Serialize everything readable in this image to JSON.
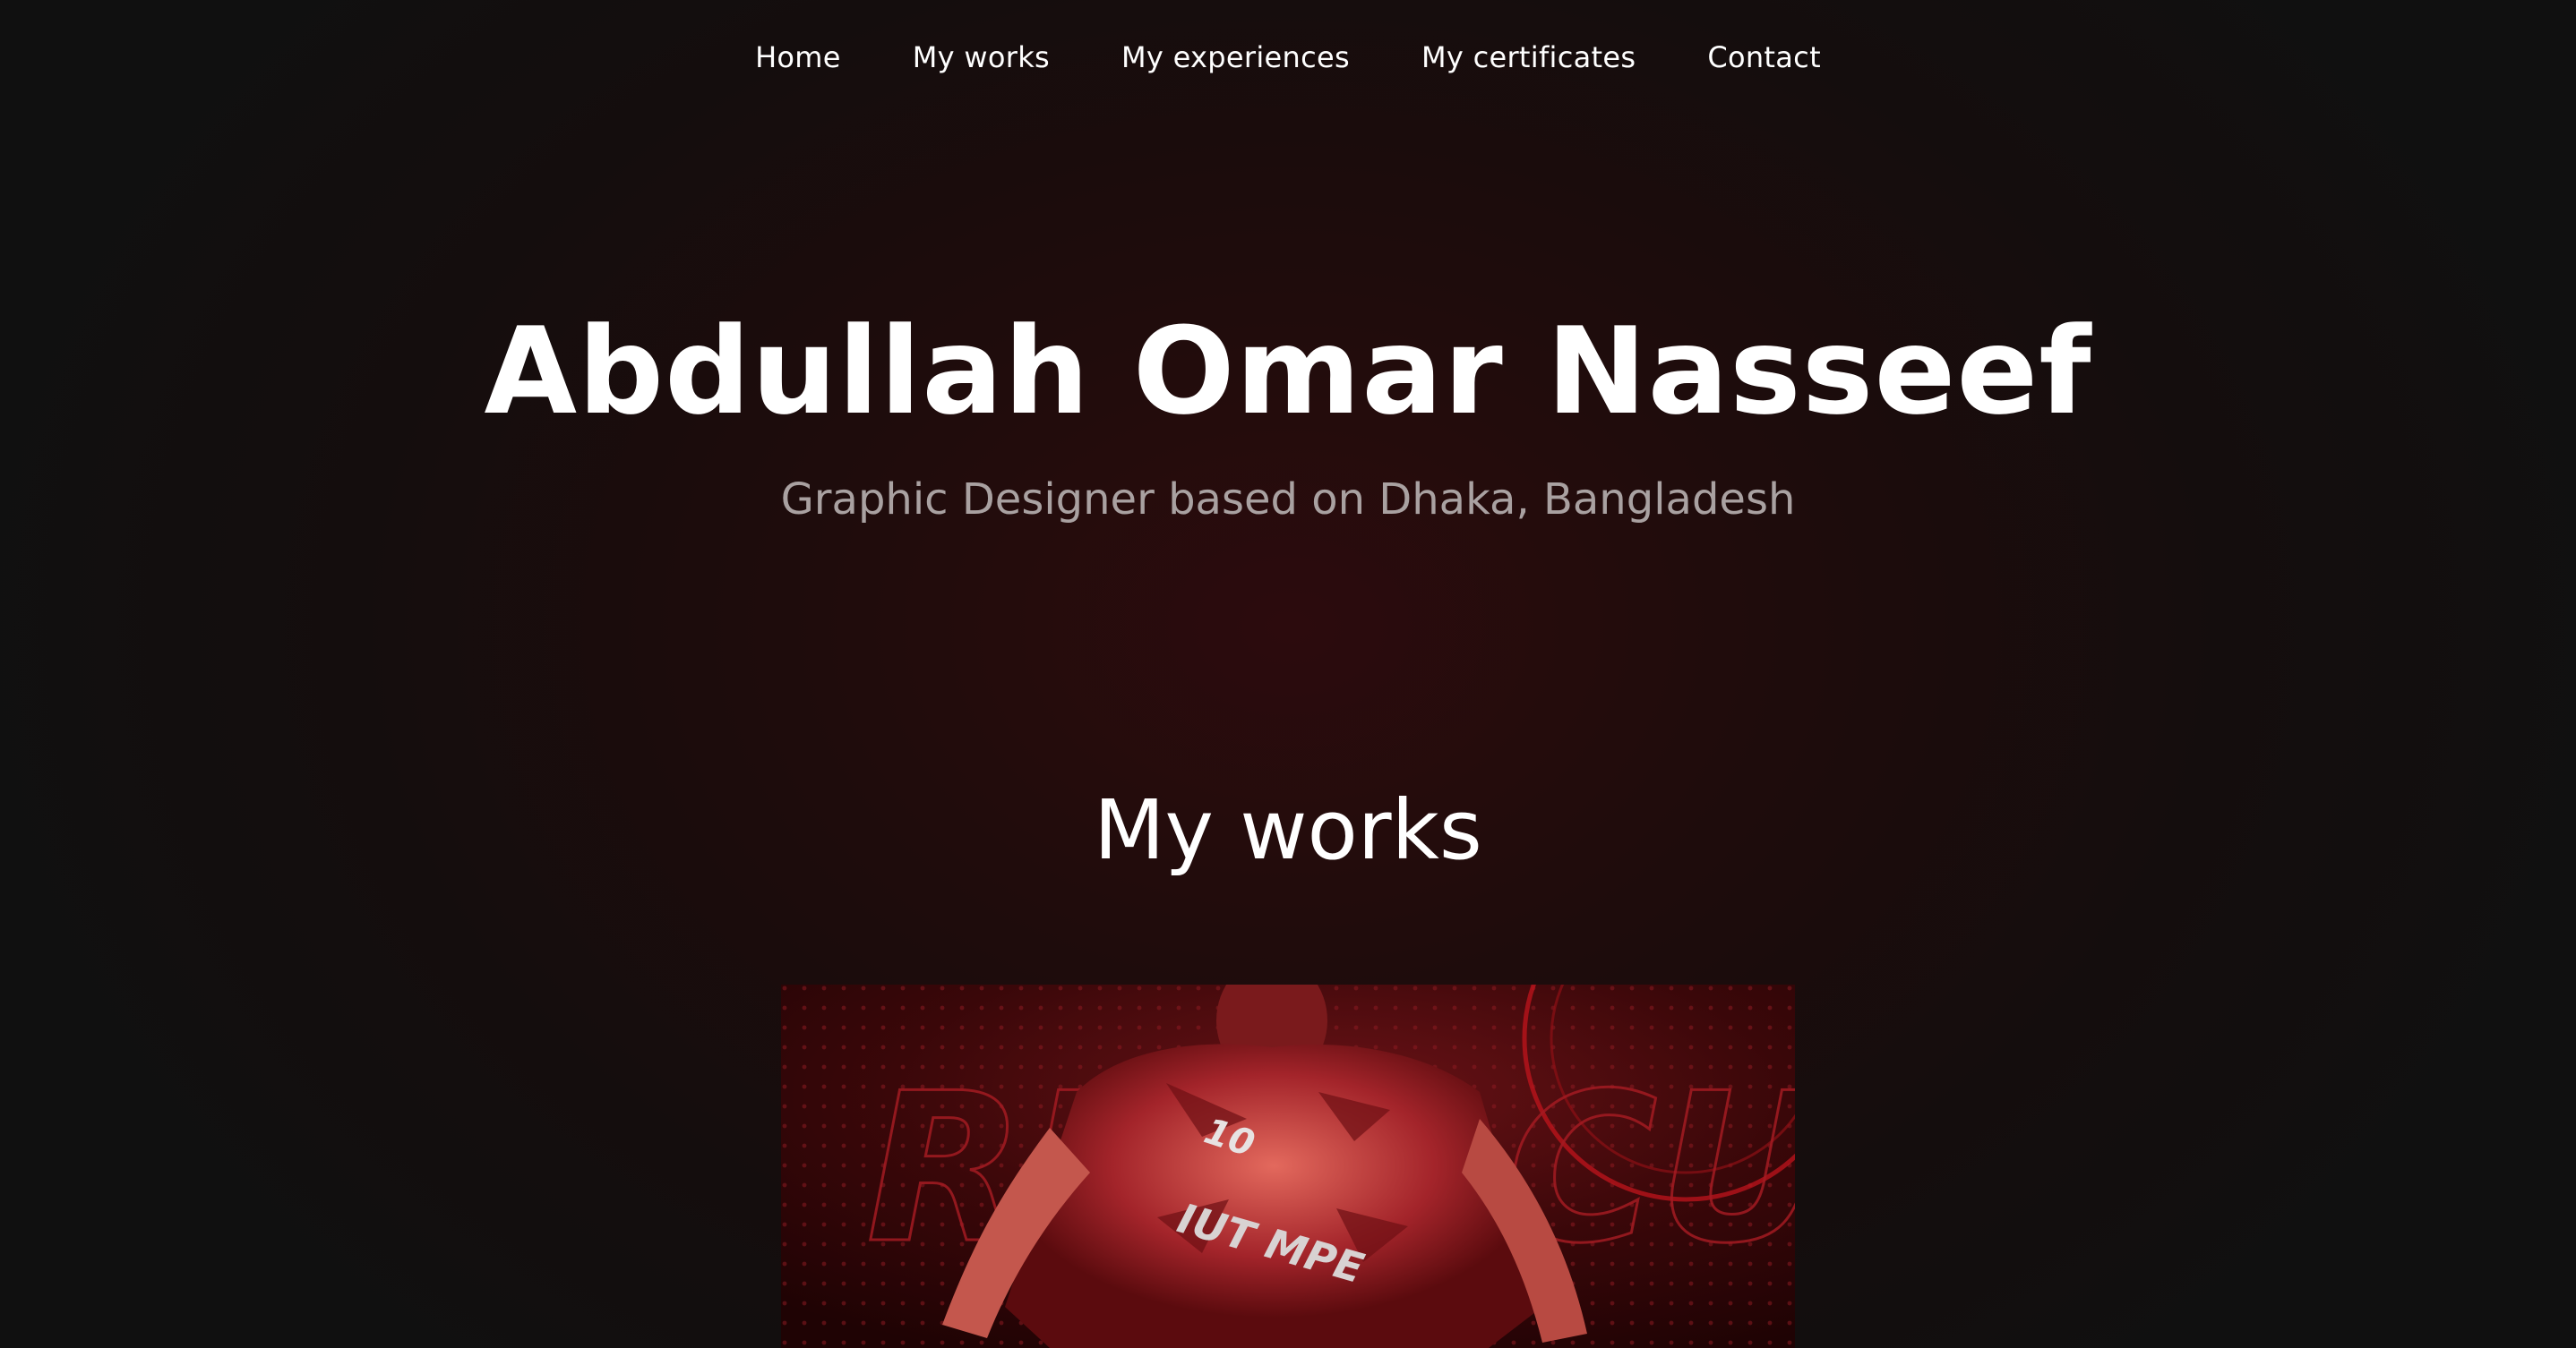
{
  "nav": {
    "items": [
      {
        "label": "Home"
      },
      {
        "label": "My works"
      },
      {
        "label": "My experiences"
      },
      {
        "label": "My certificates"
      },
      {
        "label": "Contact"
      }
    ]
  },
  "hero": {
    "name": "Abdullah Omar Nasseef",
    "tagline": "Graphic Designer based on Dhaka, Bangladesh"
  },
  "works": {
    "heading": "My works",
    "items": [
      {
        "poster_text": "RED",
        "poster_text_2": "CUP",
        "jersey_number": "10",
        "jersey_text": "IUT MPE"
      }
    ]
  },
  "colors": {
    "background": "#140d0d",
    "accent_red": "#b3121a",
    "subtitle_gray": "#a9a1a1"
  }
}
